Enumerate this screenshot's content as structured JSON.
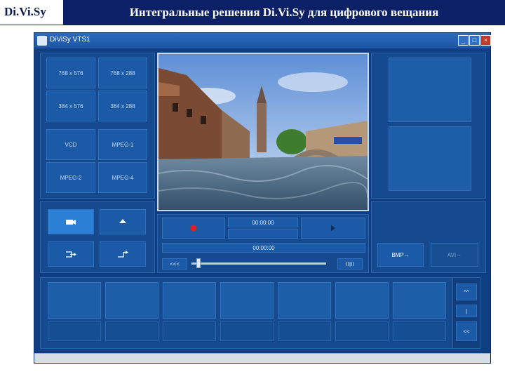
{
  "header": {
    "brand": "Di.Vi.Sy",
    "title": "Интегральные решения Di.Vi.Sy для цифрового вещания"
  },
  "window": {
    "title": "DiViSy VTS1",
    "controls": {
      "minimize": "_",
      "maximize": "□",
      "close": "×"
    }
  },
  "formats": [
    "768 x 576",
    "768 x 288",
    "384 x 576",
    "384 x 288",
    "VCD",
    "MPEG-1",
    "MPEG-2",
    "MPEG-4"
  ],
  "transport": {
    "timecode": "00:00:00",
    "timecode_secondary": "00:00:00",
    "rewind_label": "<<<",
    "slider_position": 0.05,
    "end_label": "II|II"
  },
  "right_panel": {
    "export_bmp": "BMP→",
    "export_avi": "AVI→"
  },
  "filmstrip": {
    "nav_up": "^^",
    "nav_mid": "|",
    "nav_down": "<<"
  },
  "colors": {
    "window_bg": "#0f3f82",
    "panel": "#164a8f",
    "header_bar": "#0b2066",
    "record": "#e02020"
  },
  "icons": [
    "camera-icon",
    "eject-icon",
    "import-icon",
    "export-icon",
    "record-icon",
    "play-icon"
  ]
}
